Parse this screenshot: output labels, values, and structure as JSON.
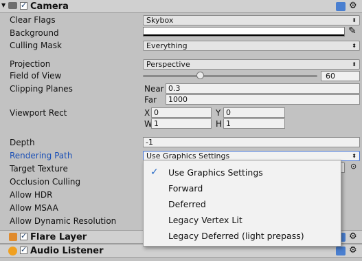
{
  "camera": {
    "title": "Camera",
    "rows": {
      "clear_flags": {
        "label": "Clear Flags",
        "value": "Skybox"
      },
      "background": {
        "label": "Background"
      },
      "culling_mask": {
        "label": "Culling Mask",
        "value": "Everything"
      },
      "projection": {
        "label": "Projection",
        "value": "Perspective"
      },
      "fov": {
        "label": "Field of View",
        "value": "60",
        "slider_fraction": 0.33
      },
      "clipping": {
        "label": "Clipping Planes",
        "near_label": "Near",
        "near": "0.3",
        "far_label": "Far",
        "far": "1000"
      },
      "viewport": {
        "label": "Viewport Rect",
        "x_label": "X",
        "x": "0",
        "y_label": "Y",
        "y": "0",
        "w_label": "W",
        "w": "1",
        "h_label": "H",
        "h": "1"
      },
      "depth": {
        "label": "Depth",
        "value": "-1"
      },
      "rendering_path": {
        "label": "Rendering Path",
        "value": "Use Graphics Settings"
      },
      "target_texture": {
        "label": "Target Texture"
      },
      "occlusion": {
        "label": "Occlusion Culling"
      },
      "hdr": {
        "label": "Allow HDR"
      },
      "msaa": {
        "label": "Allow MSAA"
      },
      "dynres": {
        "label": "Allow Dynamic Resolution"
      }
    }
  },
  "dropdown_menu": {
    "items": [
      {
        "label": "Use Graphics Settings",
        "checked": true
      },
      {
        "label": "Forward"
      },
      {
        "label": "Deferred"
      },
      {
        "label": "Legacy Vertex Lit"
      },
      {
        "label": "Legacy Deferred (light prepass)"
      }
    ],
    "check_glyph": "✓"
  },
  "components": {
    "flare_layer": "Flare Layer",
    "audio_listener": "Audio Listener"
  },
  "colors": {
    "highlight_label": "#1a4fb5",
    "menu_check": "#2a6cc8"
  }
}
